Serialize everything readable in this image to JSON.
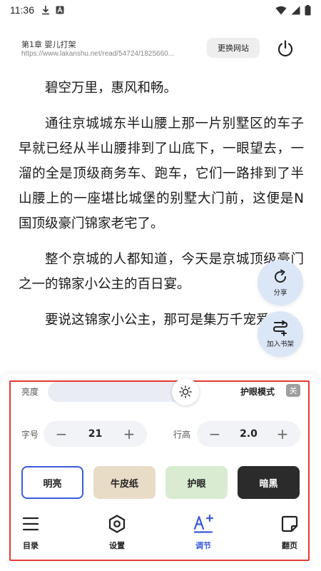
{
  "status_bar": {
    "time": "11:36"
  },
  "header": {
    "chapter_title": "第1章 婴儿打架",
    "url": "https://www.lakanshu.net/read/54724/1825660...",
    "change_site_label": "更换网站"
  },
  "article": {
    "paragraphs": [
      "碧空万里，惠风和畅。",
      "通往京城城东半山腰上那一片别墅区的车子早就已经从半山腰排到了山底下，一眼望去，一溜的全是顶级商务车、跑车，它们一路排到了半山腰上的一座堪比城堡的别墅大门前，这便是N国顶级豪门锦家老宅了。",
      "整个京城的人都知道，今天是京城顶级豪门之一的锦家小公主的百日宴。",
      "要说这锦家小公主，那可是集万千宠爱"
    ]
  },
  "floating": {
    "share_label": "分享",
    "bookshelf_label": "加入书架"
  },
  "settings": {
    "brightness_label": "亮度",
    "brightness_level": 0.9,
    "eye_mode_label": "护眼模式",
    "eye_mode_state": "关",
    "font_size_label": "字号",
    "font_size_value": "21",
    "line_height_label": "行高",
    "line_height_value": "2.0",
    "minus": "−",
    "plus": "+",
    "themes": [
      {
        "label": "明亮",
        "bg": "#ffffff",
        "fg": "#222222",
        "selected": true
      },
      {
        "label": "牛皮纸",
        "bg": "#e9dcc6",
        "fg": "#222222",
        "selected": false
      },
      {
        "label": "护眼",
        "bg": "#d9ecd2",
        "fg": "#222222",
        "selected": false
      },
      {
        "label": "暗黑",
        "bg": "#2b2b2b",
        "fg": "#ffffff",
        "selected": false
      }
    ]
  },
  "bottom_nav": {
    "catalog": "目录",
    "settings": "设置",
    "adjust": "调节",
    "page_turn": "翻页"
  },
  "colors": {
    "accent": "#3b5bdb",
    "highlight_outline": "#e53935",
    "fab_bg": "#dbe6f7"
  }
}
